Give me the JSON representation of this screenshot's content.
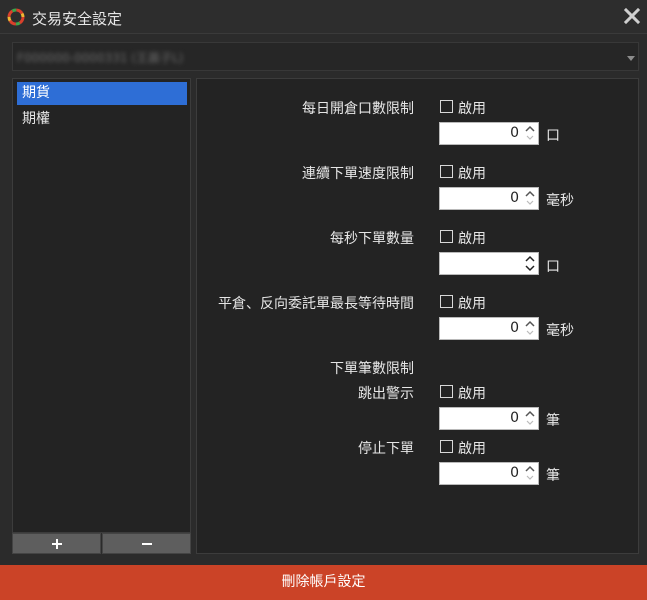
{
  "window": {
    "title": "交易安全設定",
    "icon": "app-logo-icon",
    "close_icon": "close-icon"
  },
  "account": {
    "value": "F000000-0000331 (王晨子L)",
    "icon": "chevron-down-icon"
  },
  "products": {
    "items": [
      {
        "label": "期貨",
        "selected": true
      },
      {
        "label": "期權",
        "selected": false
      }
    ],
    "add_label": "+",
    "remove_label": "−"
  },
  "settings": {
    "daily_open_limit": {
      "label": "每日開倉口數限制",
      "enable_label": "啟用",
      "enabled": false,
      "value": "0",
      "unit": "口"
    },
    "order_speed_limit": {
      "label": "連續下單速度限制",
      "enable_label": "啟用",
      "enabled": false,
      "value": "0",
      "unit": "毫秒"
    },
    "orders_per_second": {
      "label": "每秒下單數量",
      "enable_label": "啟用",
      "enabled": false,
      "value": "",
      "unit": "口"
    },
    "max_wait_time": {
      "label": "平倉、反向委託單最長等待時間",
      "enable_label": "啟用",
      "enabled": false,
      "value": "0",
      "unit": "毫秒"
    },
    "order_count_limit": {
      "label": "下單筆數限制",
      "warning": {
        "label": "跳出警示",
        "enable_label": "啟用",
        "enabled": false,
        "value": "0",
        "unit": "筆"
      },
      "stop": {
        "label": "停止下單",
        "enable_label": "啟用",
        "enabled": false,
        "value": "0",
        "unit": "筆"
      }
    }
  },
  "footer": {
    "delete_label": "刪除帳戶設定"
  },
  "colors": {
    "background": "#2b2b2b",
    "panel": "#232323",
    "selection": "#2e6ed6",
    "danger": "#cb4327"
  }
}
